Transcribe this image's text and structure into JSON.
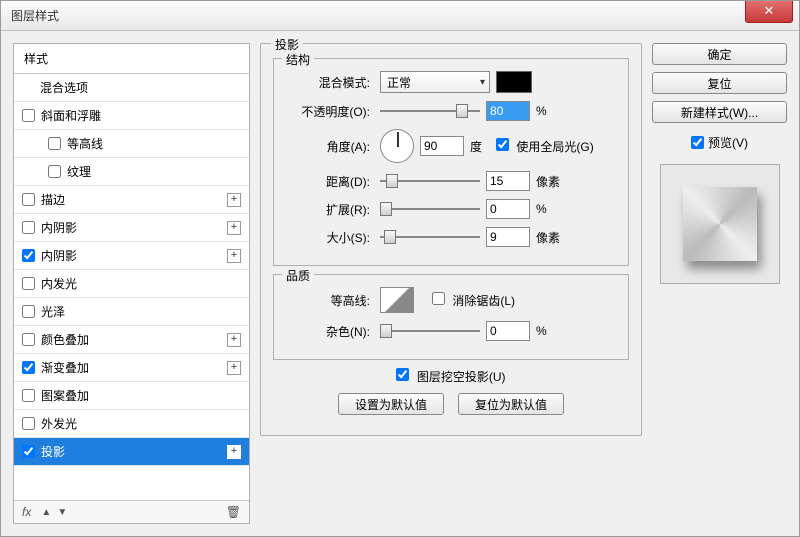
{
  "window": {
    "title": "图层样式"
  },
  "sidebar": {
    "header": "样式",
    "items": [
      {
        "label": "混合选项",
        "no_check": true
      },
      {
        "label": "斜面和浮雕",
        "checked": false
      },
      {
        "label": "等高线",
        "checked": false,
        "indent": true
      },
      {
        "label": "纹理",
        "checked": false,
        "indent": true
      },
      {
        "label": "描边",
        "checked": false,
        "plus": true
      },
      {
        "label": "内阴影",
        "checked": false,
        "plus": true
      },
      {
        "label": "内阴影",
        "checked": true,
        "plus": true
      },
      {
        "label": "内发光",
        "checked": false
      },
      {
        "label": "光泽",
        "checked": false
      },
      {
        "label": "颜色叠加",
        "checked": false,
        "plus": true
      },
      {
        "label": "渐变叠加",
        "checked": true,
        "plus": true
      },
      {
        "label": "图案叠加",
        "checked": false
      },
      {
        "label": "外发光",
        "checked": false
      },
      {
        "label": "投影",
        "checked": true,
        "plus": true,
        "selected": true
      }
    ],
    "footer_fx": "fx"
  },
  "panel": {
    "title": "投影",
    "structure": {
      "title": "结构",
      "blend_mode_label": "混合模式:",
      "blend_mode_value": "正常",
      "opacity_label": "不透明度(O):",
      "opacity_value": "80",
      "opacity_unit": "%",
      "angle_label": "角度(A):",
      "angle_value": "90",
      "angle_degree": "度",
      "global_light_label": "使用全局光(G)",
      "global_light_checked": true,
      "distance_label": "距离(D):",
      "distance_value": "15",
      "distance_unit": "像素",
      "spread_label": "扩展(R):",
      "spread_value": "0",
      "spread_unit": "%",
      "size_label": "大小(S):",
      "size_value": "9",
      "size_unit": "像素"
    },
    "quality": {
      "title": "品质",
      "contour_label": "等高线:",
      "antialias_label": "消除锯齿(L)",
      "antialias_checked": false,
      "noise_label": "杂色(N):",
      "noise_value": "0",
      "noise_unit": "%"
    },
    "knockout_label": "图层挖空投影(U)",
    "knockout_checked": true,
    "set_default": "设置为默认值",
    "reset_default": "复位为默认值"
  },
  "buttons": {
    "ok": "确定",
    "cancel": "复位",
    "new_style": "新建样式(W)...",
    "preview": "预览(V)",
    "preview_checked": true
  }
}
